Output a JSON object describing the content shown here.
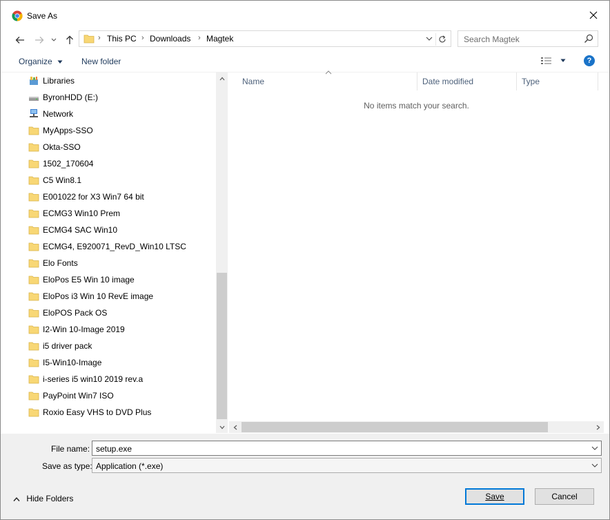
{
  "window": {
    "title": "Save As"
  },
  "address": {
    "crumbs": [
      "This PC",
      "Downloads",
      "Magtek"
    ],
    "search_placeholder": "Search Magtek"
  },
  "toolbar": {
    "organize_label": "Organize",
    "new_folder_label": "New folder"
  },
  "navpane": {
    "items": [
      {
        "label": "Libraries",
        "icon": "libraries-icon"
      },
      {
        "label": "ByronHDD (E:)",
        "icon": "drive-icon"
      },
      {
        "label": "Network",
        "icon": "network-icon"
      },
      {
        "label": "MyApps-SSO",
        "icon": "folder-icon"
      },
      {
        "label": "Okta-SSO",
        "icon": "folder-icon"
      },
      {
        "label": "1502_170604",
        "icon": "folder-icon"
      },
      {
        "label": "C5 Win8.1",
        "icon": "folder-icon"
      },
      {
        "label": "E001022 for X3 Win7 64 bit",
        "icon": "folder-icon"
      },
      {
        "label": "ECMG3 Win10 Prem",
        "icon": "folder-icon"
      },
      {
        "label": "ECMG4 SAC Win10",
        "icon": "folder-icon"
      },
      {
        "label": "ECMG4, E920071_RevD_Win10 LTSC",
        "icon": "folder-icon"
      },
      {
        "label": "Elo Fonts",
        "icon": "folder-icon"
      },
      {
        "label": "EloPos E5 Win 10 image",
        "icon": "folder-icon"
      },
      {
        "label": "EloPos i3 Win 10 RevE image",
        "icon": "folder-icon"
      },
      {
        "label": "EloPOS Pack OS",
        "icon": "folder-icon"
      },
      {
        "label": "I2-Win 10-Image 2019",
        "icon": "folder-icon"
      },
      {
        "label": "i5 driver pack",
        "icon": "folder-icon"
      },
      {
        "label": "I5-Win10-Image",
        "icon": "folder-icon"
      },
      {
        "label": "i-series i5 win10 2019 rev.a",
        "icon": "folder-icon"
      },
      {
        "label": "PayPoint Win7 ISO",
        "icon": "folder-icon"
      },
      {
        "label": "Roxio Easy VHS to DVD Plus",
        "icon": "folder-icon"
      }
    ]
  },
  "filelist": {
    "columns": [
      "Name",
      "Date modified",
      "Type"
    ],
    "empty_message": "No items match your search."
  },
  "form": {
    "file_name_label": "File name:",
    "file_name_value": "setup.exe",
    "save_type_label": "Save as type:",
    "save_type_value": "Application (*.exe)"
  },
  "footer": {
    "hide_folders_label": "Hide Folders",
    "save_label": "Save",
    "cancel_label": "Cancel"
  },
  "colors": {
    "accent": "#0078d7",
    "folder": "#f8d775",
    "help": "#1a73c8"
  }
}
